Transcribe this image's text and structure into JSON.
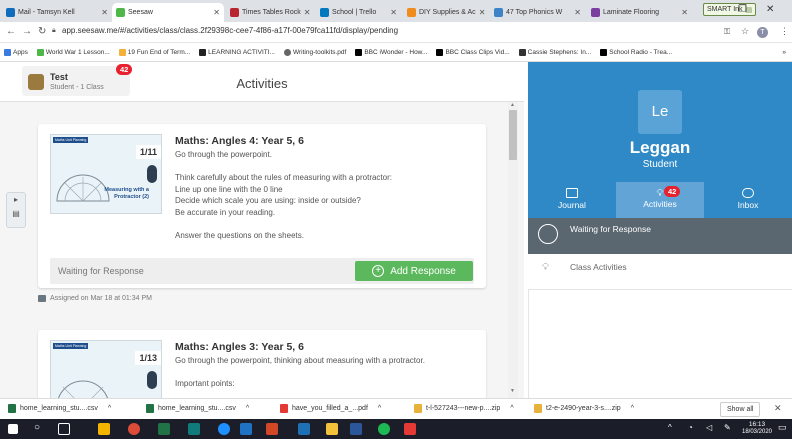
{
  "browser": {
    "tabs": [
      {
        "label": "Mail - Tamsyn Kell",
        "color": "#0f6cbd"
      },
      {
        "label": "Seesaw",
        "color": "#4fb748"
      },
      {
        "label": "Times Tables Rock",
        "color": "#b8242f"
      },
      {
        "label": "School | Trello",
        "color": "#0079bf"
      },
      {
        "label": "DIY Supplies & Ac",
        "color": "#f08b1d"
      },
      {
        "label": "47 Top Phonics W",
        "color": "#3d83c6"
      },
      {
        "label": "Laminate Flooring",
        "color": "#7b3fa0"
      }
    ],
    "smart_ink": "SMART Ink",
    "url": "app.seesaw.me/#/activities/class/class.2f29398c-cee7-4f86-a17f-00e79fca11fd/display/pending",
    "profile_initial": "T",
    "bookmarks": [
      "Apps",
      "World War 1 Lesson...",
      "19 Fun End of Term...",
      "LEARNING ACTIVITI...",
      "Writing-toolkits.pdf",
      "BBC iWonder - How...",
      "BBC Class Clips Vid...",
      "Cassie Stephens: In...",
      "School Radio - Trea..."
    ]
  },
  "header": {
    "class_name": "Test",
    "class_sub": "Student - 1 Class",
    "badge": "42",
    "title": "Activities"
  },
  "activities": [
    {
      "counter": "1/11",
      "title": "Maths: Angles 4: Year 5, 6",
      "thumb_tag": "Maths Unit Planning",
      "thumb_label": "Measuring with a Protractor (2)",
      "text": "Go through the powerpoint.\n\nThink carefully about the rules of measuring with a protractor:\nLine up one line with the 0 line\nDecide which scale you are using: inside or outside?\nBe accurate in your reading.\n\nAnswer the questions on the sheets.",
      "status": "Waiting for Response",
      "action": "Add Response",
      "assigned": "Assigned on Mar 18 at 01:34 PM"
    },
    {
      "counter": "1/13",
      "title": "Maths: Angles 3: Year 5, 6",
      "thumb_tag": "Maths Unit Planning",
      "text": "Go through the powerpoint, thinking about measuring with a protractor.\n\nImportant points:"
    }
  ],
  "profile": {
    "initials": "Le",
    "name": "Leggan",
    "role": "Student",
    "nav": [
      {
        "label": "Journal"
      },
      {
        "label": "Activities",
        "badge": "42"
      },
      {
        "label": "Inbox"
      }
    ],
    "filters": [
      {
        "label": "Waiting for Response"
      },
      {
        "label": "Class Activities"
      }
    ]
  },
  "downloads": {
    "items": [
      "home_learning_stu....csv",
      "home_learning_stu....csv",
      "have_you_filled_a_...pdf",
      "t-l-527243---new-p....zip",
      "t2-e-2490-year-3-s....zip"
    ],
    "show_all": "Show all"
  },
  "taskbar": {
    "time": "16:13",
    "date": "18/03/2020"
  },
  "colors": {
    "accent_blue": "#2f89c6",
    "active_nav": "#62a4d6",
    "green": "#5cb85c",
    "badge_red": "#e8212e",
    "filter_dark": "#5a6670"
  }
}
